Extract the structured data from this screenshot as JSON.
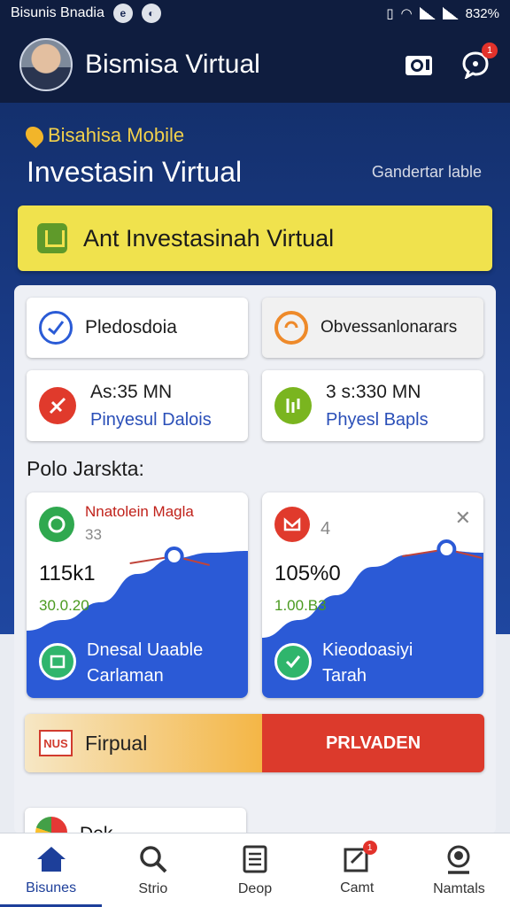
{
  "status_bar": {
    "carrier": "Bisunis Bnadia",
    "battery": "832%"
  },
  "app_bar": {
    "title": "Bismisa Virtual",
    "chat_badge": "1"
  },
  "hero": {
    "subtitle": "Bisahisa Mobile",
    "title": "Investasin Virtual",
    "link": "Gandertar lable"
  },
  "cta": {
    "label": "Ant Investasinah Virtual"
  },
  "quick_actions": [
    {
      "label": "Pledosdoia",
      "icon": "check-shield-icon"
    },
    {
      "label": "Obvessanlonarars",
      "icon": "chat-bubble-icon"
    }
  ],
  "stats": [
    {
      "value": "As:35 MN",
      "caption": "Pinyesul Dalois",
      "icon": "no-entry-icon"
    },
    {
      "value": "3 s:330 MN",
      "caption": "Phyesl Bapls",
      "icon": "document-icon"
    }
  ],
  "section_label": "Polo Jarskta:",
  "cards": [
    {
      "name": "Nnatolein Magla",
      "sub": "33",
      "value": "115k1",
      "delta": "30.0.20",
      "footer_line1": "Dnesal Uaable",
      "footer_line2": "Carlaman",
      "trend": [
        0.68,
        0.62,
        0.52,
        0.36,
        0.27,
        0.24,
        0.23
      ],
      "marker_index": 4
    },
    {
      "name": "",
      "sub": "4",
      "value": "105%0",
      "delta": "1.00.B3",
      "footer_line1": "Kieodoasiyi",
      "footer_line2": "Tarah",
      "trend": [
        0.72,
        0.62,
        0.48,
        0.32,
        0.25,
        0.23,
        0.24
      ],
      "marker_index": 5
    }
  ],
  "banner": {
    "icon_text": "NUS",
    "left_text": "Firpual",
    "right_text": "PRLVADEN"
  },
  "peek_card": {
    "text": "Dek..."
  },
  "bottom_nav": [
    {
      "label": "Bisunes",
      "icon": "home-icon",
      "active": true
    },
    {
      "label": "Strio",
      "icon": "search-icon",
      "active": false
    },
    {
      "label": "Deop",
      "icon": "clipboard-icon",
      "active": false
    },
    {
      "label": "Camt",
      "icon": "edit-note-icon",
      "active": false,
      "badge": "1"
    },
    {
      "label": "Namtals",
      "icon": "profile-icon",
      "active": false
    }
  ],
  "colors": {
    "header": "#0f1d3f",
    "hero": "#1a3d8c",
    "cta": "#f0e24d",
    "chart_fill": "#2b5ad6",
    "accent_red": "#dc3a2c"
  }
}
